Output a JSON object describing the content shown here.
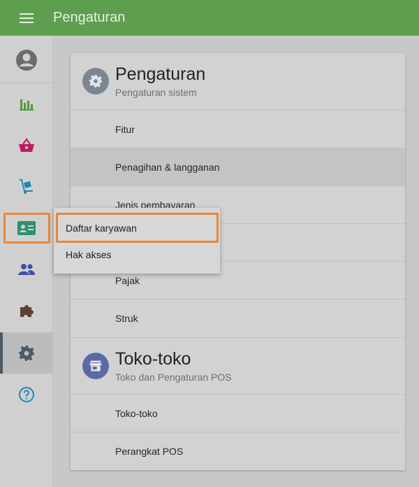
{
  "header": {
    "title": "Pengaturan"
  },
  "sidebar": {
    "items": [
      {
        "name": "account-icon",
        "color": "#6b6b6b"
      },
      {
        "name": "reports-icon",
        "color": "#4f9c3f"
      },
      {
        "name": "items-icon",
        "color": "#c2185b"
      },
      {
        "name": "inventory-icon",
        "color": "#1e88b4"
      },
      {
        "name": "employees-icon",
        "color": "#2f8f72"
      },
      {
        "name": "customers-icon",
        "color": "#3f51a5"
      },
      {
        "name": "integrations-icon",
        "color": "#5d4037"
      },
      {
        "name": "settings-icon",
        "color": "#4d5a66"
      },
      {
        "name": "help-icon",
        "color": "#1e88b4"
      }
    ]
  },
  "settings_section": {
    "title": "Pengaturan",
    "subtitle": "Pengaturan sistem",
    "rows": [
      "Fitur",
      "Penagihan & langganan",
      "Jenis pembayaran",
      "",
      "Pajak",
      "Struk"
    ]
  },
  "stores_section": {
    "title": "Toko-toko",
    "subtitle": "Toko dan Pengaturan POS",
    "rows": [
      "Toko-toko",
      "Perangkat POS"
    ]
  },
  "popup_menu": {
    "items": [
      "Daftar karyawan",
      "Hak akses"
    ]
  }
}
